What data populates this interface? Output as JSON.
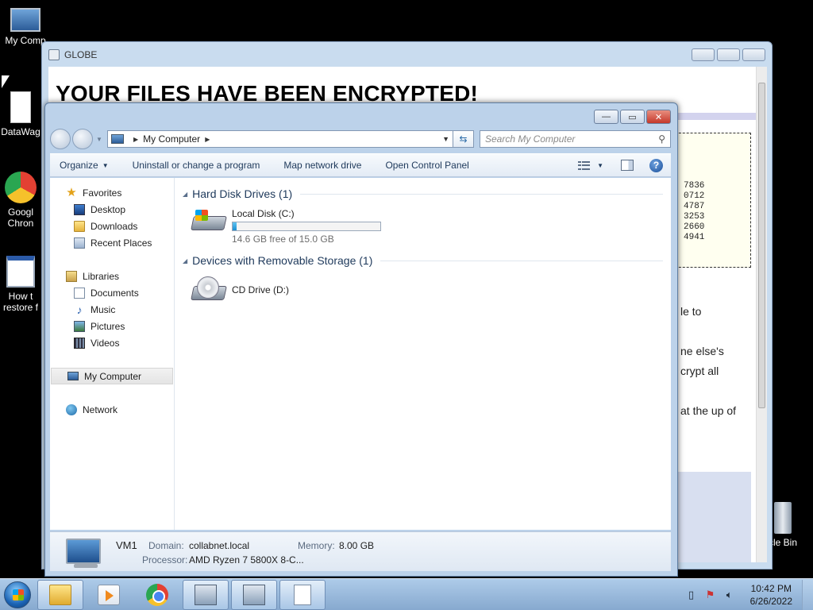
{
  "desktop": {
    "icons": [
      {
        "label": "My Comp"
      },
      {
        "label": "DataWag"
      },
      {
        "label": "Googl Chron"
      },
      {
        "label": "How t restore f"
      },
      {
        "label": "cle Bin"
      }
    ]
  },
  "globe_window": {
    "title": "GLOBE",
    "heading": "YOUR FILES HAVE BEEN ENCRYPTED!",
    "key_lines": [
      "7836",
      "0712",
      "4787",
      "3253",
      "2660",
      "4941"
    ],
    "fragments": [
      "le to",
      "ne else's",
      "crypt all",
      "at the up of"
    ]
  },
  "explorer": {
    "address": {
      "location": "My Computer"
    },
    "search": {
      "placeholder": "Search My Computer"
    },
    "window_controls": {
      "minimize": "—",
      "maximize": "▭",
      "close": "✕"
    },
    "toolbar": {
      "organize": "Organize",
      "uninstall": "Uninstall or change a program",
      "map_drive": "Map network drive",
      "control_panel": "Open Control Panel",
      "help": "?"
    },
    "nav": {
      "favorites": "Favorites",
      "desktop": "Desktop",
      "downloads": "Downloads",
      "recent_places": "Recent Places",
      "libraries": "Libraries",
      "documents": "Documents",
      "music": "Music",
      "pictures": "Pictures",
      "videos": "Videos",
      "my_computer": "My Computer",
      "network": "Network"
    },
    "groups": {
      "hard_disks": "Hard Disk Drives (1)",
      "removable": "Devices with Removable Storage (1)"
    },
    "drives": {
      "local": {
        "name": "Local Disk (C:)",
        "free_text": "14.6 GB free of 15.0 GB",
        "used_fraction": 0.027
      },
      "cd": {
        "name": "CD Drive (D:)"
      }
    },
    "details": {
      "name": "VM1",
      "domain_label": "Domain:",
      "domain": "collabnet.local",
      "memory_label": "Memory:",
      "memory": "8.00 GB",
      "processor_label": "Processor:",
      "processor": "AMD Ryzen 7 5800X 8-C..."
    }
  },
  "taskbar": {
    "time": "10:42 PM",
    "date": "6/26/2022"
  }
}
